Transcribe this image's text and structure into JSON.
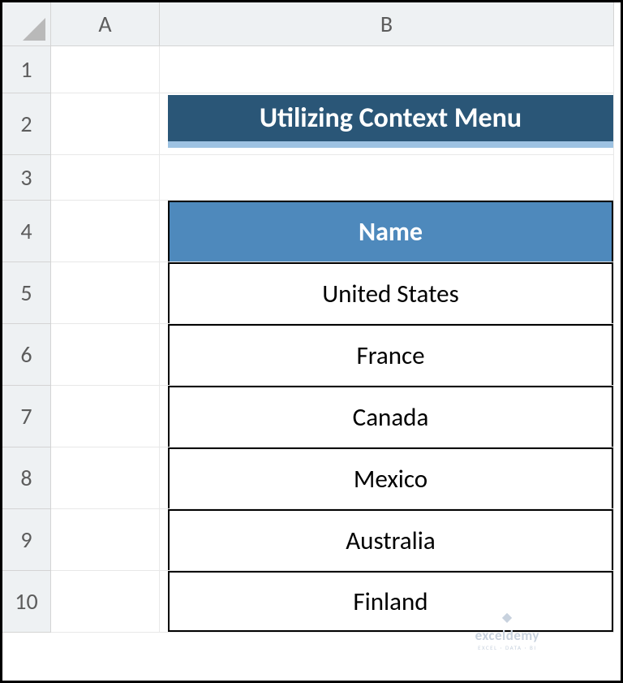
{
  "columns": {
    "A": "A",
    "B": "B"
  },
  "rows": [
    "1",
    "2",
    "3",
    "4",
    "5",
    "6",
    "7",
    "8",
    "9",
    "10"
  ],
  "title": "Utilizing Context Menu",
  "table": {
    "header": "Name",
    "items": [
      "United States",
      "France",
      "Canada",
      "Mexico",
      "Australia",
      "Finland"
    ]
  },
  "watermark": {
    "name": "exceldemy",
    "sub": "EXCEL · DATA · BI"
  }
}
